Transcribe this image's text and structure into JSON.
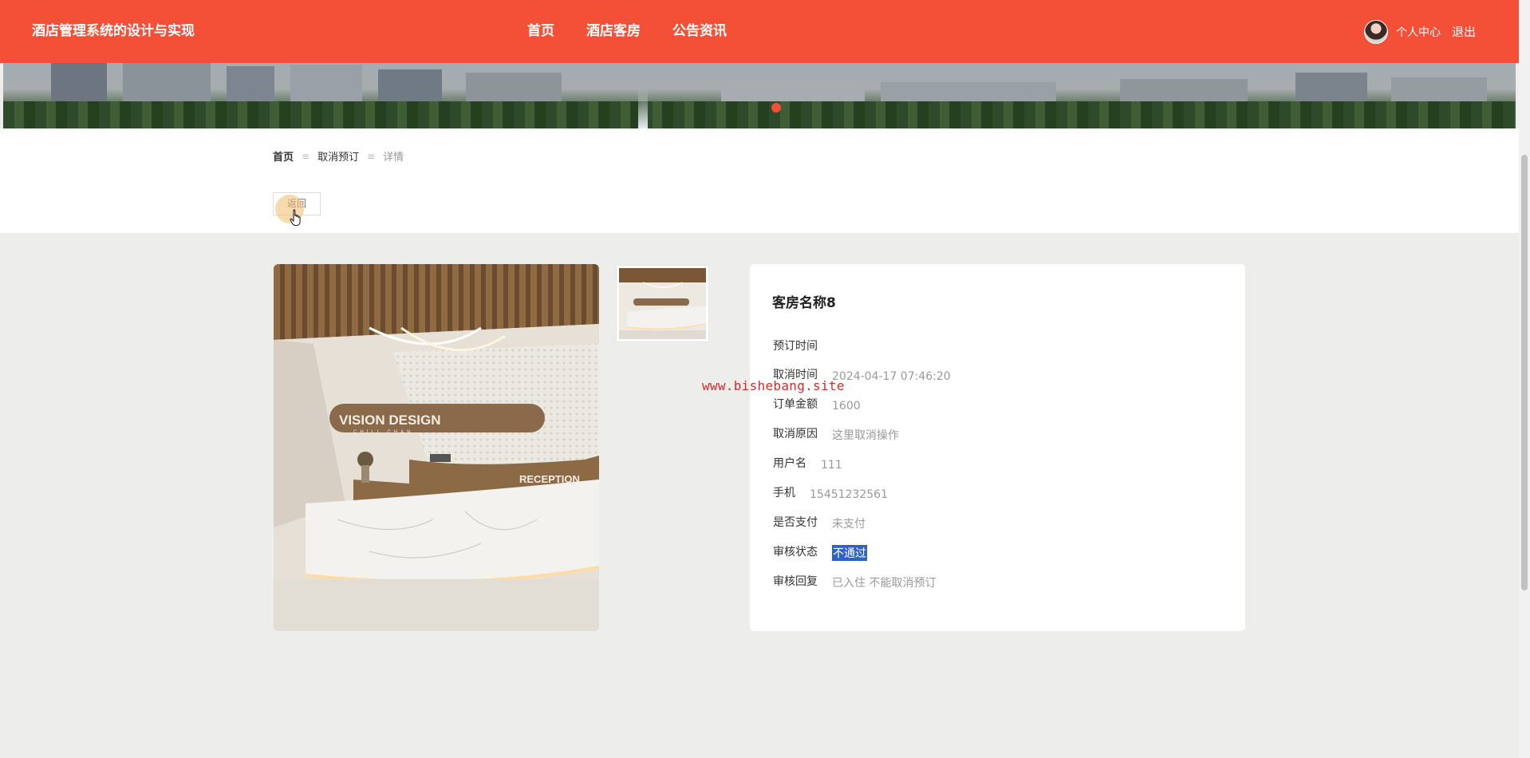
{
  "header": {
    "brand": "酒店管理系统的设计与实现",
    "nav": [
      {
        "label": "首页"
      },
      {
        "label": "酒店客房"
      },
      {
        "label": "公告资讯"
      }
    ],
    "user_center": "个人中心",
    "logout": "退出"
  },
  "breadcrumb": {
    "home": "首页",
    "section": "取消预订",
    "current": "详情",
    "separator": "≡"
  },
  "back_button": "返回",
  "gallery": {
    "logo_text": "VISION DESIGN",
    "logo_sub": "CHILL CHAN",
    "reception_text": "RECEPTION"
  },
  "detail": {
    "title": "客房名称8",
    "fields": [
      {
        "label": "预订时间",
        "value": ""
      },
      {
        "label": "取消时间",
        "value": "2024-04-17 07:46:20"
      },
      {
        "label": "订单金额",
        "value": "1600"
      },
      {
        "label": "取消原因",
        "value": "这里取消操作"
      },
      {
        "label": "用户名",
        "value": "111"
      },
      {
        "label": "手机",
        "value": "15451232561"
      },
      {
        "label": "是否支付",
        "value": "未支付"
      },
      {
        "label": "审核状态",
        "value": "不通过"
      },
      {
        "label": "审核回复",
        "value": "已入住 不能取消预订"
      }
    ]
  },
  "watermark": "www.bishebang.site",
  "colors": {
    "brand_red": "#f44f37",
    "selection_blue": "#2e63c6"
  }
}
